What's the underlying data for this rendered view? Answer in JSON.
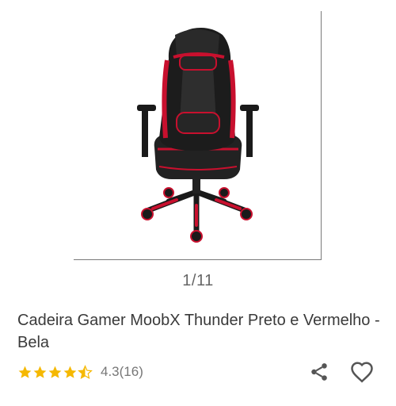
{
  "gallery": {
    "image_alt": "Cadeira Gamer MoobX Thunder Preto e Vermelho",
    "current": 1,
    "total": 11,
    "counter_text": "1/11"
  },
  "product": {
    "title": "Cadeira Gamer MoobX Thunder Preto e Vermelho - Bela",
    "rating_value": 4.3,
    "rating_count": 16,
    "rating_text": "4.3(16)"
  },
  "icons": {
    "star": "star-icon",
    "share": "share-icon",
    "favorite": "heart-icon"
  },
  "colors": {
    "star": "#f5b800",
    "chair_red": "#c8102e",
    "chair_black": "#1a1a1a"
  }
}
